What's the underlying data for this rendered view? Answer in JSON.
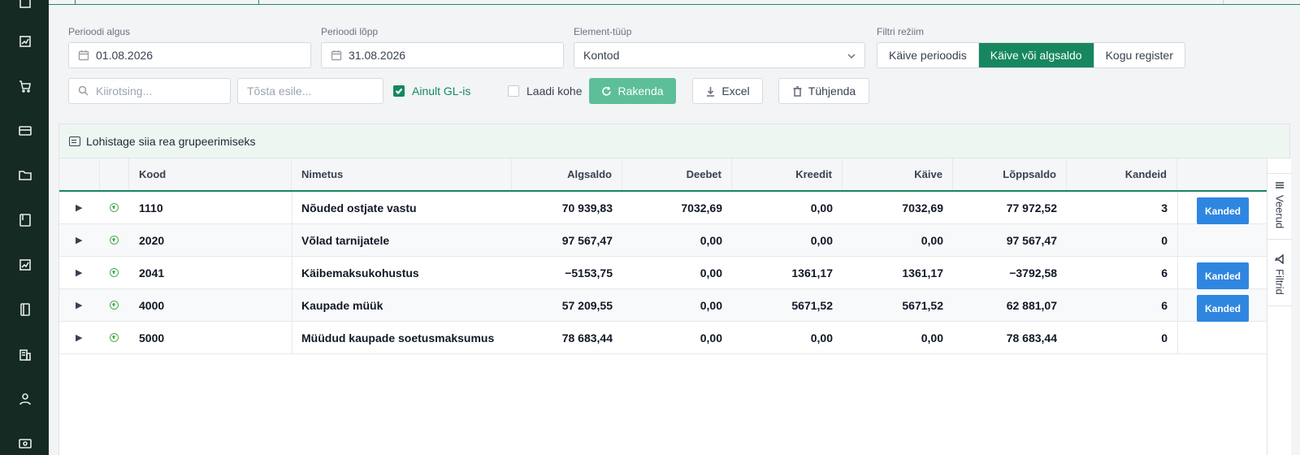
{
  "filters": {
    "period_start_label": "Perioodi algus",
    "period_start_value": "01.08.2026",
    "period_end_label": "Perioodi lõpp",
    "period_end_value": "31.08.2026",
    "element_type_label": "Element-tüüp",
    "element_type_value": "Kontod",
    "filter_mode_label": "Filtri režiim",
    "filter_modes": [
      "Käive perioodis",
      "Käive või algsaldo",
      "Kogu register"
    ],
    "filter_mode_selected": "Käive või algsaldo",
    "search_placeholder": "Kiirotsing...",
    "highlight_placeholder": "Tõsta esile...",
    "gl_only_label": "Ainult GL-is",
    "gl_only_checked": true,
    "load_now_label": "Laadi kohe",
    "load_now_checked": false,
    "apply_label": "Rakenda",
    "excel_label": "Excel",
    "clear_label": "Tühjenda"
  },
  "grid": {
    "group_hint": "Lohistage siia rea grupeerimiseks",
    "columns": [
      "Kood",
      "Nimetus",
      "Algsaldo",
      "Deebet",
      "Kreedit",
      "Käive",
      "Lõppsaldo",
      "Kandeid"
    ],
    "rows": [
      {
        "kood": "1110",
        "nimetus": "Nõuded ostjate vastu",
        "algsaldo": "70 939,83",
        "deebet": "7032,69",
        "kreedit": "0,00",
        "kaive": "7032,69",
        "loppsaldo": "77 972,52",
        "kandeid": "3",
        "action": "Kanded"
      },
      {
        "kood": "2020",
        "nimetus": "Võlad tarnijatele",
        "algsaldo": "97 567,47",
        "deebet": "0,00",
        "kreedit": "0,00",
        "kaive": "0,00",
        "loppsaldo": "97 567,47",
        "kandeid": "0",
        "action": ""
      },
      {
        "kood": "2041",
        "nimetus": "Käibemaksukohustus",
        "algsaldo": "−5153,75",
        "deebet": "0,00",
        "kreedit": "1361,17",
        "kaive": "1361,17",
        "loppsaldo": "−3792,58",
        "kandeid": "6",
        "action": "Kanded"
      },
      {
        "kood": "4000",
        "nimetus": "Kaupade müük",
        "algsaldo": "57 209,55",
        "deebet": "0,00",
        "kreedit": "5671,52",
        "kaive": "5671,52",
        "loppsaldo": "62 881,07",
        "kandeid": "6",
        "action": "Kanded"
      },
      {
        "kood": "5000",
        "nimetus": "Müüdud kaupade soetusmaksumus",
        "algsaldo": "78 683,44",
        "deebet": "0,00",
        "kreedit": "0,00",
        "kaive": "0,00",
        "loppsaldo": "78 683,44",
        "kandeid": "0",
        "action": ""
      }
    ],
    "side_tabs": [
      "Veerud",
      "Filtrid"
    ]
  },
  "colors": {
    "sidebar": "#152a22",
    "accent": "#16875f",
    "apply_button": "#5cbf98",
    "kanded_button": "#2f86e0"
  }
}
